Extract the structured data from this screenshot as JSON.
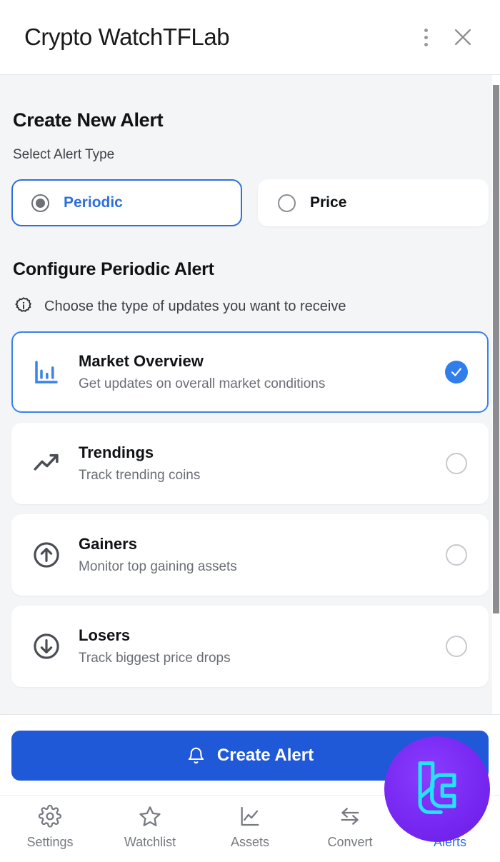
{
  "window": {
    "title": "Crypto WatchTFLab",
    "menu_icon": "kebab-menu-icon",
    "close_icon": "close-icon"
  },
  "page": {
    "heading": "Create New Alert",
    "select_type_label": "Select Alert Type"
  },
  "alert_types": [
    {
      "label": "Periodic",
      "selected": true
    },
    {
      "label": "Price",
      "selected": false
    }
  ],
  "configure": {
    "heading": "Configure Periodic Alert",
    "hint": "Choose the type of updates you want to receive",
    "hint_icon": "info-icon"
  },
  "options": [
    {
      "title": "Market Overview",
      "description": "Get updates on overall market conditions",
      "icon": "bar-chart-icon",
      "selected": true
    },
    {
      "title": "Trendings",
      "description": "Track trending coins",
      "icon": "trending-up-icon",
      "selected": false
    },
    {
      "title": "Gainers",
      "description": "Monitor top gaining assets",
      "icon": "arrow-up-circle-icon",
      "selected": false
    },
    {
      "title": "Losers",
      "description": "Track biggest price drops",
      "icon": "arrow-down-circle-icon",
      "selected": false
    }
  ],
  "footer": {
    "create_alert_label": "Create Alert",
    "create_alert_icon": "bell-icon"
  },
  "bottom_nav": [
    {
      "label": "Settings",
      "icon": "gear-icon",
      "active": false
    },
    {
      "label": "Watchlist",
      "icon": "star-icon",
      "active": false
    },
    {
      "label": "Assets",
      "icon": "line-chart-icon",
      "active": false
    },
    {
      "label": "Convert",
      "icon": "swap-arrows-icon",
      "active": false
    },
    {
      "label": "Alerts",
      "icon": "bell-icon",
      "active": true
    }
  ],
  "logo_badge": {
    "icon": "lc-logo-icon"
  },
  "colors": {
    "accent_blue": "#2e6fe0",
    "primary_button": "#2059d8",
    "check_blue": "#2f7eec",
    "badge_purple": "#7526f0",
    "badge_logo_cyan": "#22e4f5",
    "page_background": "#f4f5f7",
    "card_background": "#ffffff",
    "text_primary": "#111215",
    "text_secondary": "#6b6e76",
    "nav_inactive": "#76797f"
  }
}
